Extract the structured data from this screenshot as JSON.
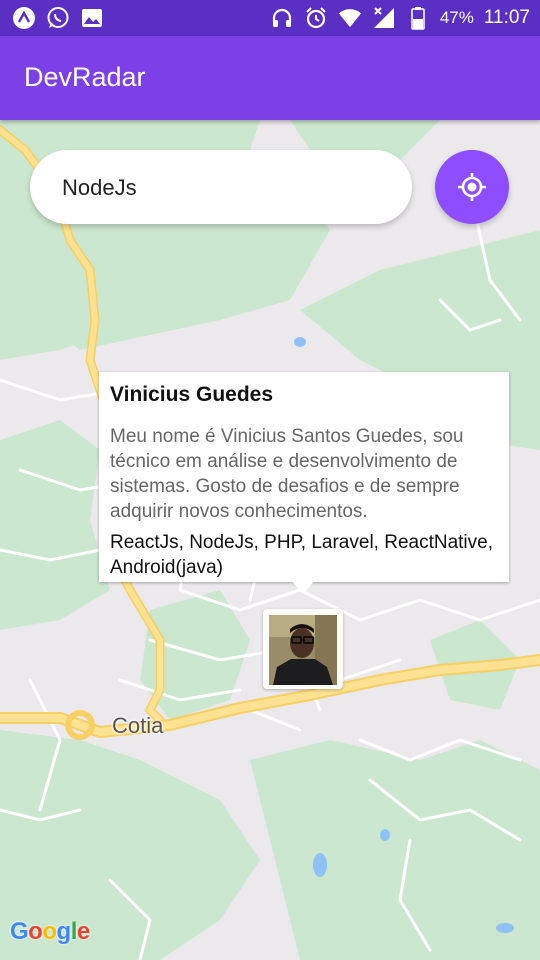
{
  "status_bar": {
    "battery": "47%",
    "time": "11:07",
    "left_icons": [
      "app-a-icon",
      "whatsapp-icon",
      "gallery-icon"
    ],
    "right_icons": [
      "headphones-icon",
      "alarm-icon",
      "wifi-icon",
      "signal-icon",
      "battery-icon"
    ]
  },
  "app_bar": {
    "title": "DevRadar"
  },
  "search": {
    "value": "NodeJs"
  },
  "callout": {
    "name": "Vinicius Guedes",
    "bio": "Meu nome é Vinicius Santos Guedes, sou técnico em análise e desenvolvimento de sistemas. Gosto de desafios e de sempre adquirir novos conhecimentos.",
    "techs": "ReactJs, NodeJs, PHP, Laravel, ReactNative, Android(java)"
  },
  "map": {
    "place_label": "Cotia",
    "attribution": [
      "G",
      "o",
      "o",
      "g",
      "l",
      "e"
    ]
  },
  "colors": {
    "status_bar": "#5b2fc3",
    "app_bar": "#7d40e7",
    "accent_button": "#8e4dff"
  }
}
